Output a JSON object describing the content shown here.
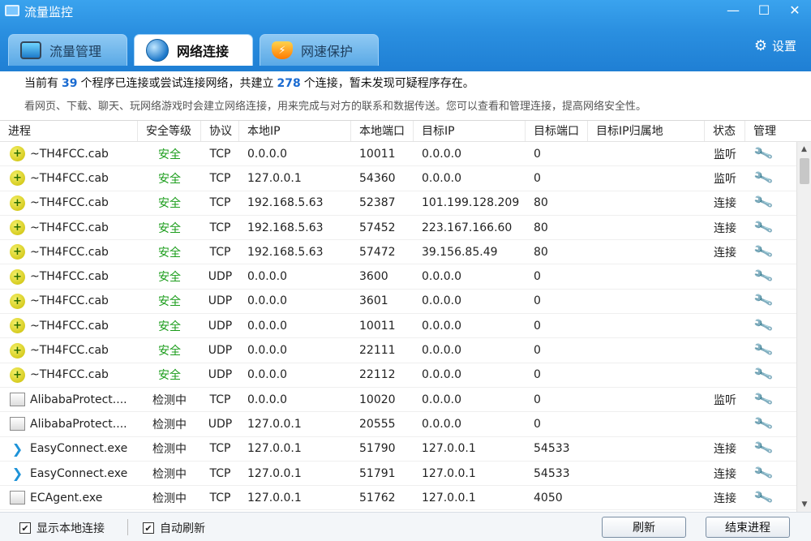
{
  "window": {
    "title": "流量监控",
    "controls": [
      "—",
      "☐",
      "✕"
    ]
  },
  "tabs": [
    {
      "label": "流量管理",
      "icon": "monitor-icon",
      "active": false
    },
    {
      "label": "网络连接",
      "icon": "globe-icon",
      "active": true
    },
    {
      "label": "网速保护",
      "icon": "shield-bolt-icon",
      "active": false
    }
  ],
  "settings": {
    "label": "设置",
    "icon": "gear-icon"
  },
  "summary": {
    "prefix": "当前有",
    "program_count": "39",
    "middle": "个程序已连接或尝试连接网络，共建立",
    "connection_count": "278",
    "suffix": "个连接，暂未发现可疑程序存在。"
  },
  "hint": "看网页、下载、聊天、玩网络游戏时会建立网络连接，用来完成与对方的联系和数据传送。您可以查看和管理连接，提高网络安全性。",
  "table": {
    "columns": [
      "进程",
      "安全等级",
      "协议",
      "本地IP",
      "本地端口",
      "目标IP",
      "目标端口",
      "目标IP归属地",
      "状态",
      "管理"
    ],
    "rows": [
      {
        "process": "~TH4FCC.cab",
        "icon": "cab",
        "security": "安全",
        "protocol": "TCP",
        "local_ip": "0.0.0.0",
        "local_port": "10011",
        "remote_ip": "0.0.0.0",
        "remote_port": "0",
        "location": "",
        "state": "监听"
      },
      {
        "process": "~TH4FCC.cab",
        "icon": "cab",
        "security": "安全",
        "protocol": "TCP",
        "local_ip": "127.0.0.1",
        "local_port": "54360",
        "remote_ip": "0.0.0.0",
        "remote_port": "0",
        "location": "",
        "state": "监听"
      },
      {
        "process": "~TH4FCC.cab",
        "icon": "cab",
        "security": "安全",
        "protocol": "TCP",
        "local_ip": "192.168.5.63",
        "local_port": "52387",
        "remote_ip": "101.199.128.209",
        "remote_port": "80",
        "location": "",
        "state": "连接"
      },
      {
        "process": "~TH4FCC.cab",
        "icon": "cab",
        "security": "安全",
        "protocol": "TCP",
        "local_ip": "192.168.5.63",
        "local_port": "57452",
        "remote_ip": "223.167.166.60",
        "remote_port": "80",
        "location": "",
        "state": "连接"
      },
      {
        "process": "~TH4FCC.cab",
        "icon": "cab",
        "security": "安全",
        "protocol": "TCP",
        "local_ip": "192.168.5.63",
        "local_port": "57472",
        "remote_ip": "39.156.85.49",
        "remote_port": "80",
        "location": "",
        "state": "连接"
      },
      {
        "process": "~TH4FCC.cab",
        "icon": "cab",
        "security": "安全",
        "protocol": "UDP",
        "local_ip": "0.0.0.0",
        "local_port": "3600",
        "remote_ip": "0.0.0.0",
        "remote_port": "0",
        "location": "",
        "state": ""
      },
      {
        "process": "~TH4FCC.cab",
        "icon": "cab",
        "security": "安全",
        "protocol": "UDP",
        "local_ip": "0.0.0.0",
        "local_port": "3601",
        "remote_ip": "0.0.0.0",
        "remote_port": "0",
        "location": "",
        "state": ""
      },
      {
        "process": "~TH4FCC.cab",
        "icon": "cab",
        "security": "安全",
        "protocol": "UDP",
        "local_ip": "0.0.0.0",
        "local_port": "10011",
        "remote_ip": "0.0.0.0",
        "remote_port": "0",
        "location": "",
        "state": ""
      },
      {
        "process": "~TH4FCC.cab",
        "icon": "cab",
        "security": "安全",
        "protocol": "UDP",
        "local_ip": "0.0.0.0",
        "local_port": "22111",
        "remote_ip": "0.0.0.0",
        "remote_port": "0",
        "location": "",
        "state": ""
      },
      {
        "process": "~TH4FCC.cab",
        "icon": "cab",
        "security": "安全",
        "protocol": "UDP",
        "local_ip": "0.0.0.0",
        "local_port": "22112",
        "remote_ip": "0.0.0.0",
        "remote_port": "0",
        "location": "",
        "state": ""
      },
      {
        "process": "AlibabaProtect....",
        "icon": "blank",
        "security": "检测中",
        "protocol": "TCP",
        "local_ip": "0.0.0.0",
        "local_port": "10020",
        "remote_ip": "0.0.0.0",
        "remote_port": "0",
        "location": "",
        "state": "监听"
      },
      {
        "process": "AlibabaProtect....",
        "icon": "blank",
        "security": "检测中",
        "protocol": "UDP",
        "local_ip": "127.0.0.1",
        "local_port": "20555",
        "remote_ip": "0.0.0.0",
        "remote_port": "0",
        "location": "",
        "state": ""
      },
      {
        "process": "EasyConnect.exe",
        "icon": "easyconnect",
        "security": "检测中",
        "protocol": "TCP",
        "local_ip": "127.0.0.1",
        "local_port": "51790",
        "remote_ip": "127.0.0.1",
        "remote_port": "54533",
        "location": "",
        "state": "连接"
      },
      {
        "process": "EasyConnect.exe",
        "icon": "easyconnect",
        "security": "检测中",
        "protocol": "TCP",
        "local_ip": "127.0.0.1",
        "local_port": "51791",
        "remote_ip": "127.0.0.1",
        "remote_port": "54533",
        "location": "",
        "state": "连接"
      },
      {
        "process": "ECAgent.exe",
        "icon": "blank",
        "security": "检测中",
        "protocol": "TCP",
        "local_ip": "127.0.0.1",
        "local_port": "51762",
        "remote_ip": "127.0.0.1",
        "remote_port": "4050",
        "location": "",
        "state": "连接"
      }
    ],
    "manage_icon": "wrench-icon"
  },
  "footer": {
    "show_local": {
      "label": "显示本地连接",
      "checked": true
    },
    "auto_refresh": {
      "label": "自动刷新",
      "checked": true
    },
    "refresh_button": "刷新",
    "end_process_button": "结束进程"
  },
  "colors": {
    "titlebar": "#2a8fe0",
    "safe": "#1a9c1a",
    "count": "#1a6bd1"
  }
}
